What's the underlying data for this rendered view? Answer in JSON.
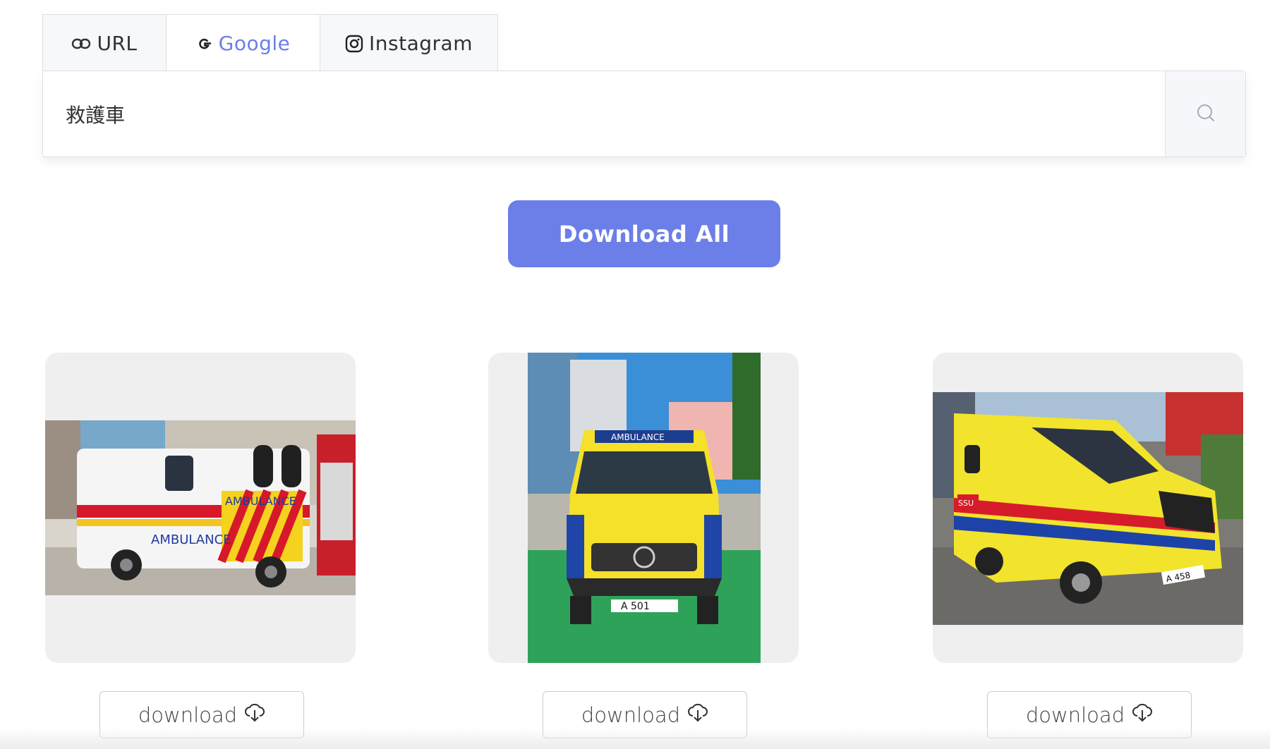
{
  "tabs": [
    {
      "label": "URL",
      "icon": "link-icon"
    },
    {
      "label": "Google",
      "icon": "google-icon",
      "active": true
    },
    {
      "label": "Instagram",
      "icon": "instagram-icon"
    }
  ],
  "search": {
    "value": "救護車",
    "icon": "search-icon"
  },
  "download_all_label": "Download All",
  "results": [
    {
      "download_label": "download",
      "icon": "cloud-download-icon"
    },
    {
      "download_label": "download",
      "icon": "cloud-download-icon"
    },
    {
      "download_label": "download",
      "icon": "cloud-download-icon"
    }
  ],
  "colors": {
    "accent": "#6c7ee8",
    "active_tab_text": "#6a7fe6",
    "border": "#dcdfe6",
    "card_bg": "#efefef"
  }
}
